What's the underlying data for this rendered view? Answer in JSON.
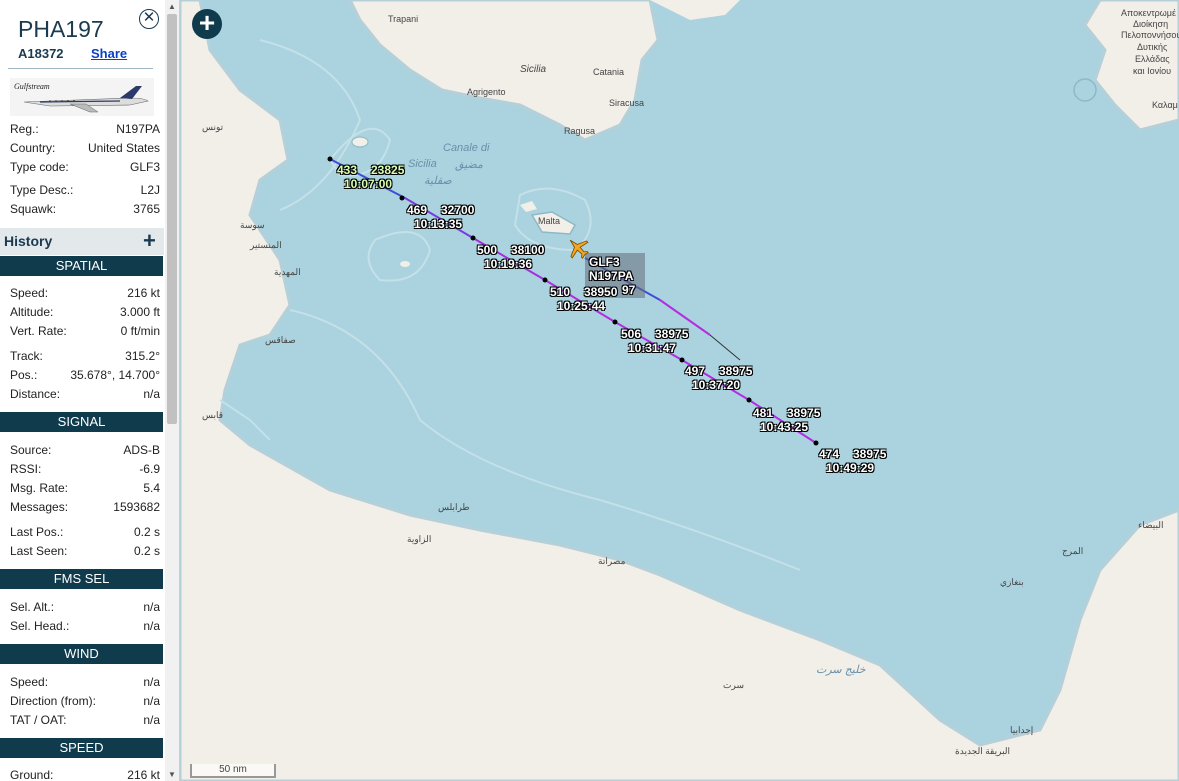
{
  "header": {
    "callsign": "PHA197",
    "hex": "A18372",
    "share": "Share",
    "photo_text": "Gulfstream"
  },
  "details": [
    {
      "k": "Reg.:",
      "v": "N197PA"
    },
    {
      "k": "Country:",
      "v": "United States"
    },
    {
      "k": "Type code:",
      "v": "GLF3"
    },
    {
      "k": "Type Desc.:",
      "v": "L2J"
    },
    {
      "k": "Squawk:",
      "v": "3765"
    }
  ],
  "history_label": "History",
  "spatial": {
    "title": "SPATIAL",
    "rows": [
      {
        "k": "Speed:",
        "v": "216 kt"
      },
      {
        "k": "Altitude:",
        "v": "3.000 ft"
      },
      {
        "k": "Vert. Rate:",
        "v": "0 ft/min"
      },
      {
        "k": "Track:",
        "v": "315.2°"
      },
      {
        "k": "Pos.:",
        "v": "35.678°, 14.700°"
      },
      {
        "k": "Distance:",
        "v": "n/a"
      }
    ]
  },
  "signal": {
    "title": "SIGNAL",
    "rows": [
      {
        "k": "Source:",
        "v": "ADS-B"
      },
      {
        "k": "RSSI:",
        "v": "-6.9"
      },
      {
        "k": "Msg. Rate:",
        "v": "5.4"
      },
      {
        "k": "Messages:",
        "v": "1593682"
      },
      {
        "k": "Last Pos.:",
        "v": "0.2 s"
      },
      {
        "k": "Last Seen:",
        "v": "0.2 s"
      }
    ]
  },
  "fms": {
    "title": "FMS SEL",
    "rows": [
      {
        "k": "Sel. Alt.:",
        "v": "n/a"
      },
      {
        "k": "Sel. Head.:",
        "v": "n/a"
      }
    ]
  },
  "wind": {
    "title": "WIND",
    "rows": [
      {
        "k": "Speed:",
        "v": "n/a"
      },
      {
        "k": "Direction (from):",
        "v": "n/a"
      },
      {
        "k": "TAT / OAT:",
        "v": "n/a"
      }
    ]
  },
  "speed": {
    "title": "SPEED",
    "rows": [
      {
        "k": "Ground:",
        "v": "216 kt"
      }
    ]
  },
  "map": {
    "scale": "50 nm",
    "aircraft_label": {
      "type": "GLF3",
      "reg": "N197PA",
      "partial": "97"
    },
    "track_labels": [
      {
        "spd": "433",
        "alt": "23825",
        "time": "10:07:00"
      },
      {
        "spd": "469",
        "alt": "32700",
        "time": "10:13:35"
      },
      {
        "spd": "500",
        "alt": "38100",
        "time": "10:19:36"
      },
      {
        "spd": "510",
        "alt": "38950",
        "time": "10:25:44"
      },
      {
        "spd": "506",
        "alt": "38975",
        "time": "10:31:47"
      },
      {
        "spd": "497",
        "alt": "38975",
        "time": "10:37:20"
      },
      {
        "spd": "481",
        "alt": "38975",
        "time": "10:43:25"
      },
      {
        "spd": "474",
        "alt": "38975",
        "time": "10:49:29"
      }
    ],
    "places": {
      "trapani": "Trapani",
      "sicilia": "Sicilia",
      "catania": "Catania",
      "agrigento": "Agrigento",
      "siracusa": "Siracusa",
      "ragusa": "Ragusa",
      "malta": "Malta",
      "canale1": "Canale di",
      "canale2": "Sicilia",
      "canale_ar1": "مضيق",
      "canale_ar2": "صقلية",
      "tunis": "تونس",
      "sousse": "سوسة",
      "monastir": "المنستير",
      "mahdia": "المهدية",
      "sfax": "صفاقس",
      "gabes": "قابس",
      "tripoli": "طرابلس",
      "zawiya": "الزاوية",
      "misrata": "مصراتة",
      "sirte": "سرت",
      "gulf_sirte": "خليج سرت",
      "benghazi": "بنغازي",
      "bayda": "البيضاء",
      "marj": "المرج",
      "greek1": "Αποκεντρωμέ",
      "greek2": "Διοίκηση",
      "greek3": "Πελοποννήσου",
      "greek4": "Δυτικής",
      "greek5": "Ελλάδας",
      "greek6": "και Ιονίου",
      "kalam": "Καλαμ",
      "ajdabiya": "إجدابيا",
      "brega": "البريقة الجديدة"
    }
  }
}
